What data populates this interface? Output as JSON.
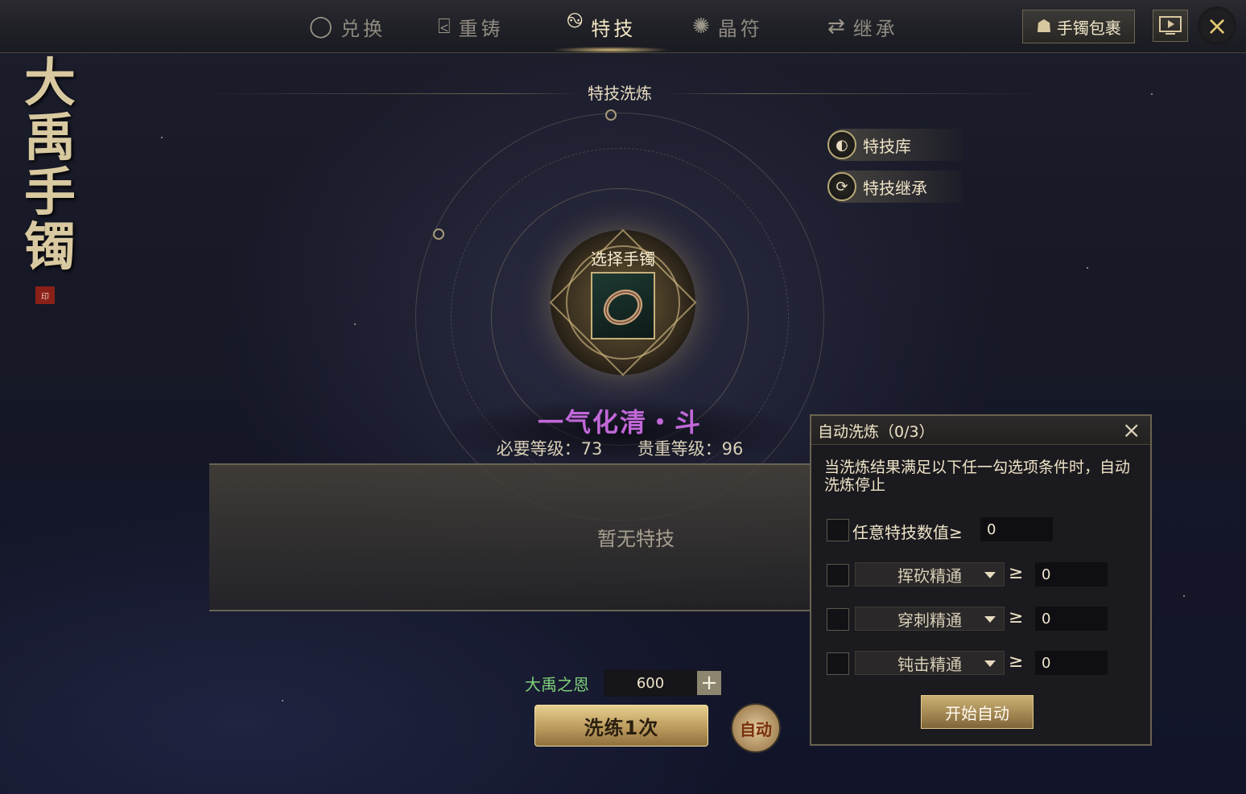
{
  "nav": {
    "tabs": [
      {
        "label": "兑换",
        "icon": "exchange-icon",
        "active": false
      },
      {
        "label": "重铸",
        "icon": "recast-icon",
        "active": false
      },
      {
        "label": "特技",
        "icon": "skill-icon",
        "active": true
      },
      {
        "label": "晶符",
        "icon": "rune-icon",
        "active": false
      },
      {
        "label": "继承",
        "icon": "inherit-icon",
        "active": false
      }
    ],
    "bag_button": "手镯包裹",
    "close_icon": "×"
  },
  "title_art": {
    "text": "大禹手镯",
    "seal": "印"
  },
  "section": {
    "title": "特技洗炼"
  },
  "side_buttons": {
    "library": "特技库",
    "inherit": "特技继承"
  },
  "center": {
    "select_label": "选择手镯",
    "skill_name": "一气化清・斗",
    "required_level": "必要等级：73",
    "precious_level": "贵重等级：96",
    "empty_text": "暂无特技"
  },
  "bottom": {
    "currency_label": "大禹之恩",
    "currency_value": "600",
    "plus": "+",
    "refine_button": "洗练1次",
    "auto_button": "自动"
  },
  "auto_panel": {
    "title": "自动洗炼（0/3）",
    "close": "×",
    "description": "当洗炼结果满足以下任一勾选项条件时，自动洗炼停止",
    "any_label": "任意特技数值≥",
    "any_value": "0",
    "gte": "≥",
    "conditions": [
      {
        "option": "挥砍精通",
        "value": "0"
      },
      {
        "option": "穿刺精通",
        "value": "0"
      },
      {
        "option": "钝击精通",
        "value": "0"
      }
    ],
    "start_button": "开始自动"
  },
  "colors": {
    "skill_name": "#c168d8",
    "currency_label": "#7fd07a",
    "gold_accent": "#e6c872"
  }
}
